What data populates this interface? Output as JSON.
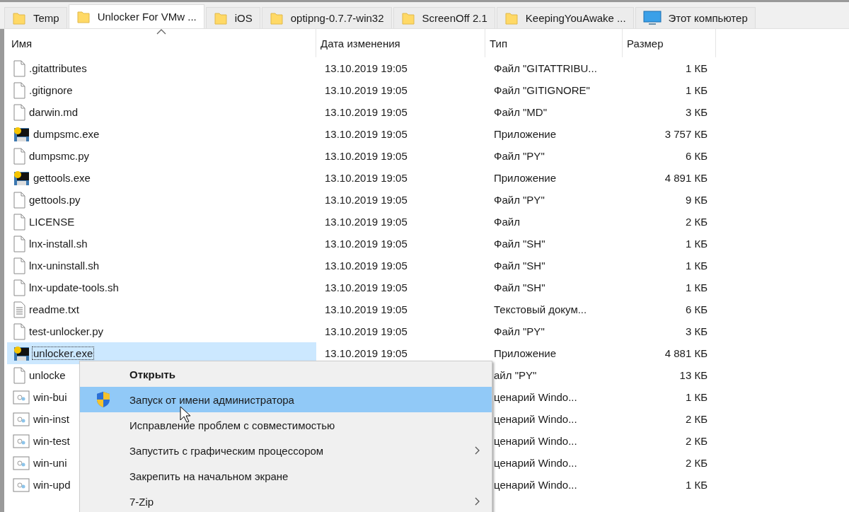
{
  "tabs": [
    {
      "label": "Temp",
      "kind": "folder",
      "selected": false
    },
    {
      "label": "Unlocker For VMw ...",
      "kind": "folder",
      "selected": true
    },
    {
      "label": "iOS",
      "kind": "folder",
      "selected": false
    },
    {
      "label": "optipng-0.7.7-win32",
      "kind": "folder",
      "selected": false
    },
    {
      "label": "ScreenOff 2.1",
      "kind": "folder",
      "selected": false
    },
    {
      "label": "KeepingYouAwake ...",
      "kind": "folder",
      "selected": false
    },
    {
      "label": "Этот компьютер",
      "kind": "computer",
      "selected": false
    }
  ],
  "table": {
    "columns": [
      {
        "label": "Имя",
        "sorted": true
      },
      {
        "label": "Дата изменения",
        "sorted": false
      },
      {
        "label": "Тип",
        "sorted": false
      },
      {
        "label": "Размер",
        "sorted": false
      }
    ],
    "rows": [
      {
        "kind": "file",
        "name": ".gitattributes",
        "date": "13.10.2019 19:05",
        "type": "Файл \"GITATTRIBU...",
        "size": "1 КБ",
        "selected": false
      },
      {
        "kind": "file",
        "name": ".gitignore",
        "date": "13.10.2019 19:05",
        "type": "Файл \"GITIGNORE\"",
        "size": "1 КБ",
        "selected": false
      },
      {
        "kind": "file",
        "name": "darwin.md",
        "date": "13.10.2019 19:05",
        "type": "Файл \"MD\"",
        "size": "3 КБ",
        "selected": false
      },
      {
        "kind": "exe",
        "name": "dumpsmc.exe",
        "date": "13.10.2019 19:05",
        "type": "Приложение",
        "size": "3 757 КБ",
        "selected": false
      },
      {
        "kind": "file",
        "name": "dumpsmc.py",
        "date": "13.10.2019 19:05",
        "type": "Файл \"PY\"",
        "size": "6 КБ",
        "selected": false
      },
      {
        "kind": "exe",
        "name": "gettools.exe",
        "date": "13.10.2019 19:05",
        "type": "Приложение",
        "size": "4 891 КБ",
        "selected": false
      },
      {
        "kind": "file",
        "name": "gettools.py",
        "date": "13.10.2019 19:05",
        "type": "Файл \"PY\"",
        "size": "9 КБ",
        "selected": false
      },
      {
        "kind": "file",
        "name": "LICENSE",
        "date": "13.10.2019 19:05",
        "type": "Файл",
        "size": "2 КБ",
        "selected": false
      },
      {
        "kind": "file",
        "name": "lnx-install.sh",
        "date": "13.10.2019 19:05",
        "type": "Файл \"SH\"",
        "size": "1 КБ",
        "selected": false
      },
      {
        "kind": "file",
        "name": "lnx-uninstall.sh",
        "date": "13.10.2019 19:05",
        "type": "Файл \"SH\"",
        "size": "1 КБ",
        "selected": false
      },
      {
        "kind": "file",
        "name": "lnx-update-tools.sh",
        "date": "13.10.2019 19:05",
        "type": "Файл \"SH\"",
        "size": "1 КБ",
        "selected": false
      },
      {
        "kind": "text",
        "name": "readme.txt",
        "date": "13.10.2019 19:05",
        "type": "Текстовый докум...",
        "size": "6 КБ",
        "selected": false
      },
      {
        "kind": "file",
        "name": "test-unlocker.py",
        "date": "13.10.2019 19:05",
        "type": "Файл \"PY\"",
        "size": "3 КБ",
        "selected": false
      },
      {
        "kind": "exe",
        "name": "unlocker.exe",
        "date": "13.10.2019 19:05",
        "type": "Приложение",
        "size": "4 881 КБ",
        "selected": true
      },
      {
        "kind": "file",
        "name": "unlocke",
        "type": "айл \"PY\"",
        "size": "13 КБ",
        "selected": false
      },
      {
        "kind": "script",
        "name": "win-bui",
        "type": "ценарий Windo...",
        "size": "1 КБ",
        "selected": false
      },
      {
        "kind": "script",
        "name": "win-inst",
        "type": "ценарий Windo...",
        "size": "2 КБ",
        "selected": false
      },
      {
        "kind": "script",
        "name": "win-test",
        "type": "ценарий Windo...",
        "size": "2 КБ",
        "selected": false
      },
      {
        "kind": "script",
        "name": "win-uni",
        "type": "ценарий Windo...",
        "size": "2 КБ",
        "selected": false
      },
      {
        "kind": "script",
        "name": "win-upd",
        "type": "ценарий Windo...",
        "size": "1 КБ",
        "selected": false
      }
    ]
  },
  "context_menu": {
    "items": [
      {
        "label": "Открыть",
        "bold": true,
        "kind": "plain",
        "submenu": false,
        "selected": false
      },
      {
        "label": "Запуск от имени администратора",
        "bold": false,
        "kind": "shield",
        "submenu": false,
        "selected": true
      },
      {
        "label": "Исправление проблем с совместимостью",
        "bold": false,
        "kind": "plain",
        "submenu": false,
        "selected": false
      },
      {
        "label": "Запустить с графическим процессором",
        "bold": false,
        "kind": "plain",
        "submenu": true,
        "selected": false
      },
      {
        "label": "Закрепить на начальном экране",
        "bold": false,
        "kind": "plain",
        "submenu": false,
        "selected": false
      },
      {
        "label": "7-Zip",
        "bold": false,
        "kind": "plain",
        "submenu": true,
        "selected": false
      }
    ]
  }
}
